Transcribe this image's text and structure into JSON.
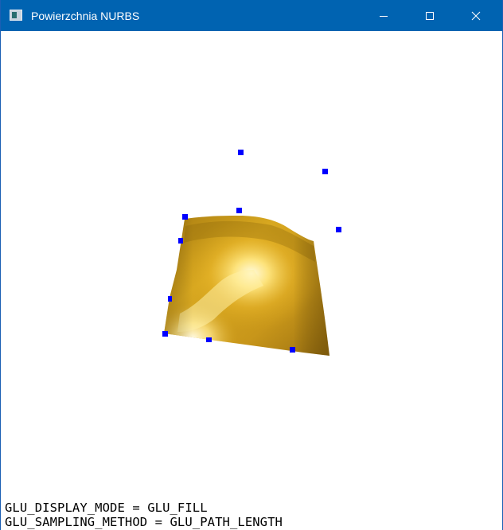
{
  "window": {
    "title": "Powierzchnia NURBS",
    "titlebar_color": "#0063b1",
    "icon": "window-app-icon",
    "controls": {
      "minimize_icon": "minimize-icon",
      "maximize_icon": "maximize-icon",
      "close_icon": "close-icon"
    }
  },
  "scene": {
    "surface_color": "#d4a21a",
    "highlight_color": "#fff2a8",
    "control_point_color": "#0000ff"
  },
  "status": {
    "display_mode": "GLU_DISPLAY_MODE = GLU_FILL",
    "sampling_method": "GLU_SAMPLING_METHOD = GLU_PATH_LENGTH"
  }
}
